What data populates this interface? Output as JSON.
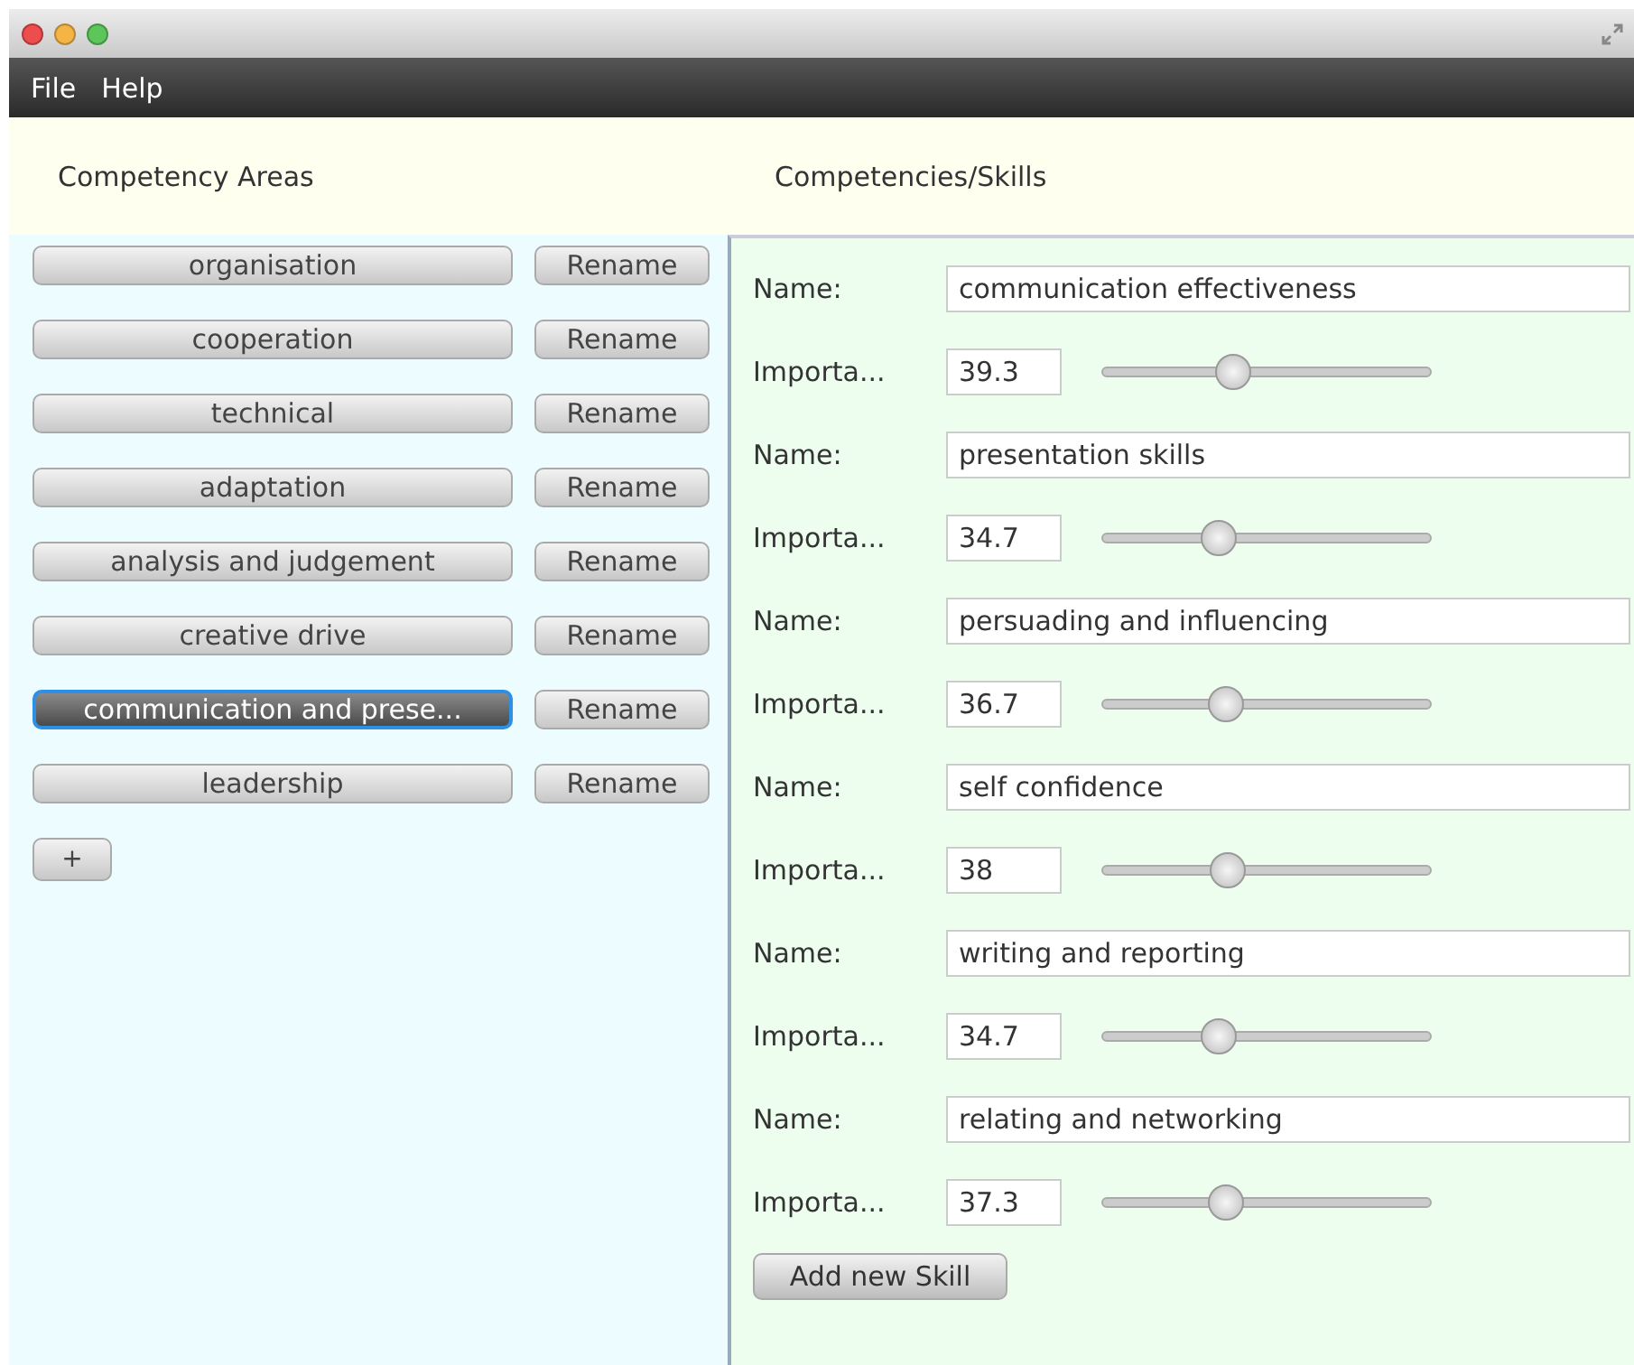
{
  "menu": [
    "File",
    "Help"
  ],
  "areas_panel": {
    "title": "Competency Areas",
    "add_label": "+",
    "items": [
      {
        "label": "organisation",
        "rename": "Rename",
        "selected": false
      },
      {
        "label": "cooperation",
        "rename": "Rename",
        "selected": false
      },
      {
        "label": "technical",
        "rename": "Rename",
        "selected": false
      },
      {
        "label": "adaptation",
        "rename": "Rename",
        "selected": false
      },
      {
        "label": "analysis and judgement",
        "rename": "Rename",
        "selected": false
      },
      {
        "label": "creative drive",
        "rename": "Rename",
        "selected": false
      },
      {
        "label": "communication and prese...",
        "rename": "Rename",
        "selected": true
      },
      {
        "label": "leadership",
        "rename": "Rename",
        "selected": false
      }
    ]
  },
  "skills_panel": {
    "title": "Competencies/Skills",
    "add_button": "Add new Skill",
    "skills": [
      {
        "name_label": "Name:",
        "name": "communication effectiveness",
        "importance_label": "Importa...",
        "importance": "39.3",
        "level": 0.4
      },
      {
        "name_label": "Name:",
        "name": "presentation skills",
        "importance_label": "Importa...",
        "importance": "34.7",
        "level": 0.355
      },
      {
        "name_label": "Name:",
        "name": "persuading and influencing",
        "importance_label": "Importa...",
        "importance": "36.7",
        "level": 0.375
      },
      {
        "name_label": "Name:",
        "name": "self confidence",
        "importance_label": "Importa...",
        "importance": "38",
        "level": 0.38
      },
      {
        "name_label": "Name:",
        "name": "writing and reporting",
        "importance_label": "Importa...",
        "importance": "34.7",
        "level": 0.355
      },
      {
        "name_label": "Name:",
        "name": "relating and networking",
        "importance_label": "Importa...",
        "importance": "37.3",
        "level": 0.375
      }
    ]
  }
}
